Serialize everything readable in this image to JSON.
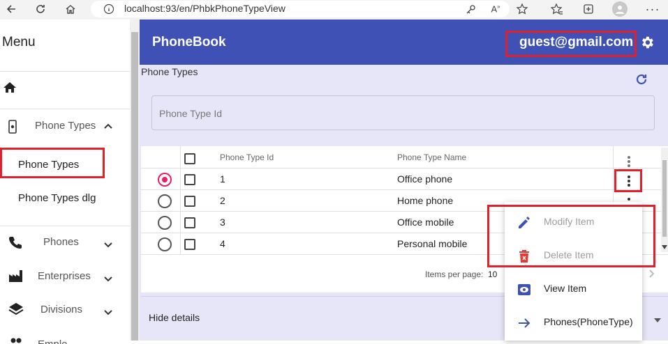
{
  "browser": {
    "url": "localhost:93/en/PhbkPhoneTypeView"
  },
  "sidebar": {
    "title": "Menu",
    "group": "Phone Types",
    "items": [
      {
        "label": "Phone Types"
      },
      {
        "label": "Phone Types dlg"
      }
    ],
    "sections": [
      {
        "label": "Phones"
      },
      {
        "label": "Enterprises"
      },
      {
        "label": "Divisions"
      },
      {
        "label": "Emplo..."
      }
    ]
  },
  "header": {
    "title": "PhoneBook",
    "user": "guest@gmail.com"
  },
  "page": {
    "section_title": "Phone Types",
    "filter_placeholder": "Phone Type Id",
    "details_label": "Hide details"
  },
  "table": {
    "columns": [
      "Phone Type Id",
      "Phone Type Name"
    ],
    "rows": [
      {
        "id": "1",
        "name": "Office phone",
        "selected": true
      },
      {
        "id": "2",
        "name": "Home phone",
        "selected": false
      },
      {
        "id": "3",
        "name": "Office mobile",
        "selected": false
      },
      {
        "id": "4",
        "name": "Personal mobile",
        "selected": false
      }
    ],
    "items_per_page_label": "Items per page:",
    "items_per_page_value": "10"
  },
  "context_menu": {
    "items": [
      {
        "label": "Modify Item",
        "enabled": false
      },
      {
        "label": "Delete Item",
        "enabled": false
      },
      {
        "label": "View Item",
        "enabled": true
      },
      {
        "label": "Phones(PhoneType)",
        "enabled": true
      }
    ]
  },
  "colors": {
    "header_bg": "#3f51b5",
    "content_bg": "#e6e6f8",
    "highlight": "#e0202a",
    "radio_selected": "#e91e63"
  }
}
